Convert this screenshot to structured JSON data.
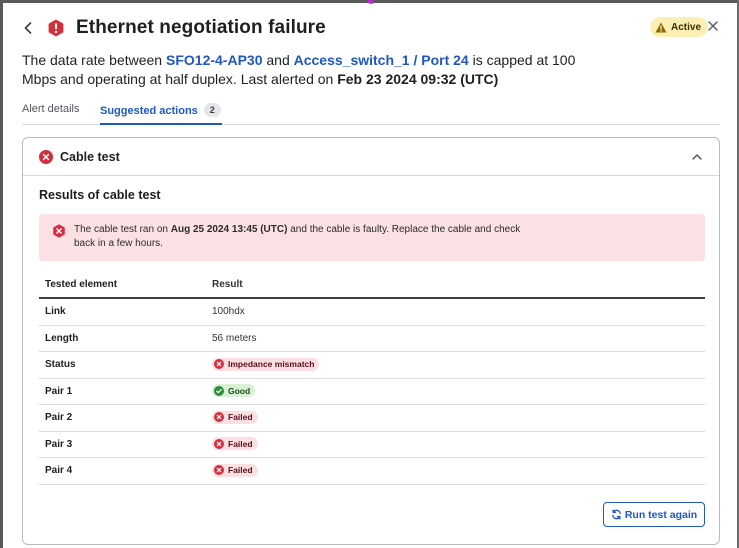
{
  "header": {
    "title": "Ethernet negotiation failure",
    "status_badge": "Active"
  },
  "description": {
    "prefix": "The data rate between ",
    "device": "SFO12-4-AP30",
    "mid": " and ",
    "switch_port": "Access_switch_1 / Port 24",
    "line_tail": " is capped at 100 Mbps and operating at half duplex. Last alerted on ",
    "alert_time": "Feb 23 2024 09:32 (UTC)"
  },
  "tabs": [
    {
      "label": "Alert details"
    },
    {
      "label": "Suggested actions",
      "count": "2"
    }
  ],
  "card": {
    "title": "Cable test",
    "results_title": "Results of cable test",
    "banner": {
      "prefix": "The cable test ran on ",
      "date": "Aug 25 2024 13:45 (UTC)",
      "suffix": " and the cable is faulty. Replace the cable and check back in a few hours."
    },
    "table": {
      "columns": [
        "Tested element",
        "Result"
      ],
      "rows": [
        {
          "element": "Link",
          "result": "100hdx"
        },
        {
          "element": "Length",
          "result": "56 meters"
        },
        {
          "element": "Status",
          "result": "Impedance mismatch",
          "kind": "bad"
        },
        {
          "element": "Pair 1",
          "result": "Good",
          "kind": "good"
        },
        {
          "element": "Pair 2",
          "result": "Failed",
          "kind": "bad"
        },
        {
          "element": "Pair 3",
          "result": "Failed",
          "kind": "bad"
        },
        {
          "element": "Pair 4",
          "result": "Failed",
          "kind": "bad"
        }
      ]
    },
    "run_button": "Run test again"
  },
  "colors": {
    "link_blue": "#1f57c5",
    "error_red": "#d32f3f",
    "success_green": "#2e8b3a",
    "warning_bg": "#fcefb4",
    "error_banner_bg": "#fbe1e3"
  },
  "icons": {
    "back": "chevron-left-icon",
    "alert": "alert-hexagon-icon",
    "warning": "warning-triangle-icon",
    "close": "close-icon",
    "card_status": "x-circle-icon",
    "collapse": "chevron-up-icon",
    "run": "refresh-icon"
  }
}
